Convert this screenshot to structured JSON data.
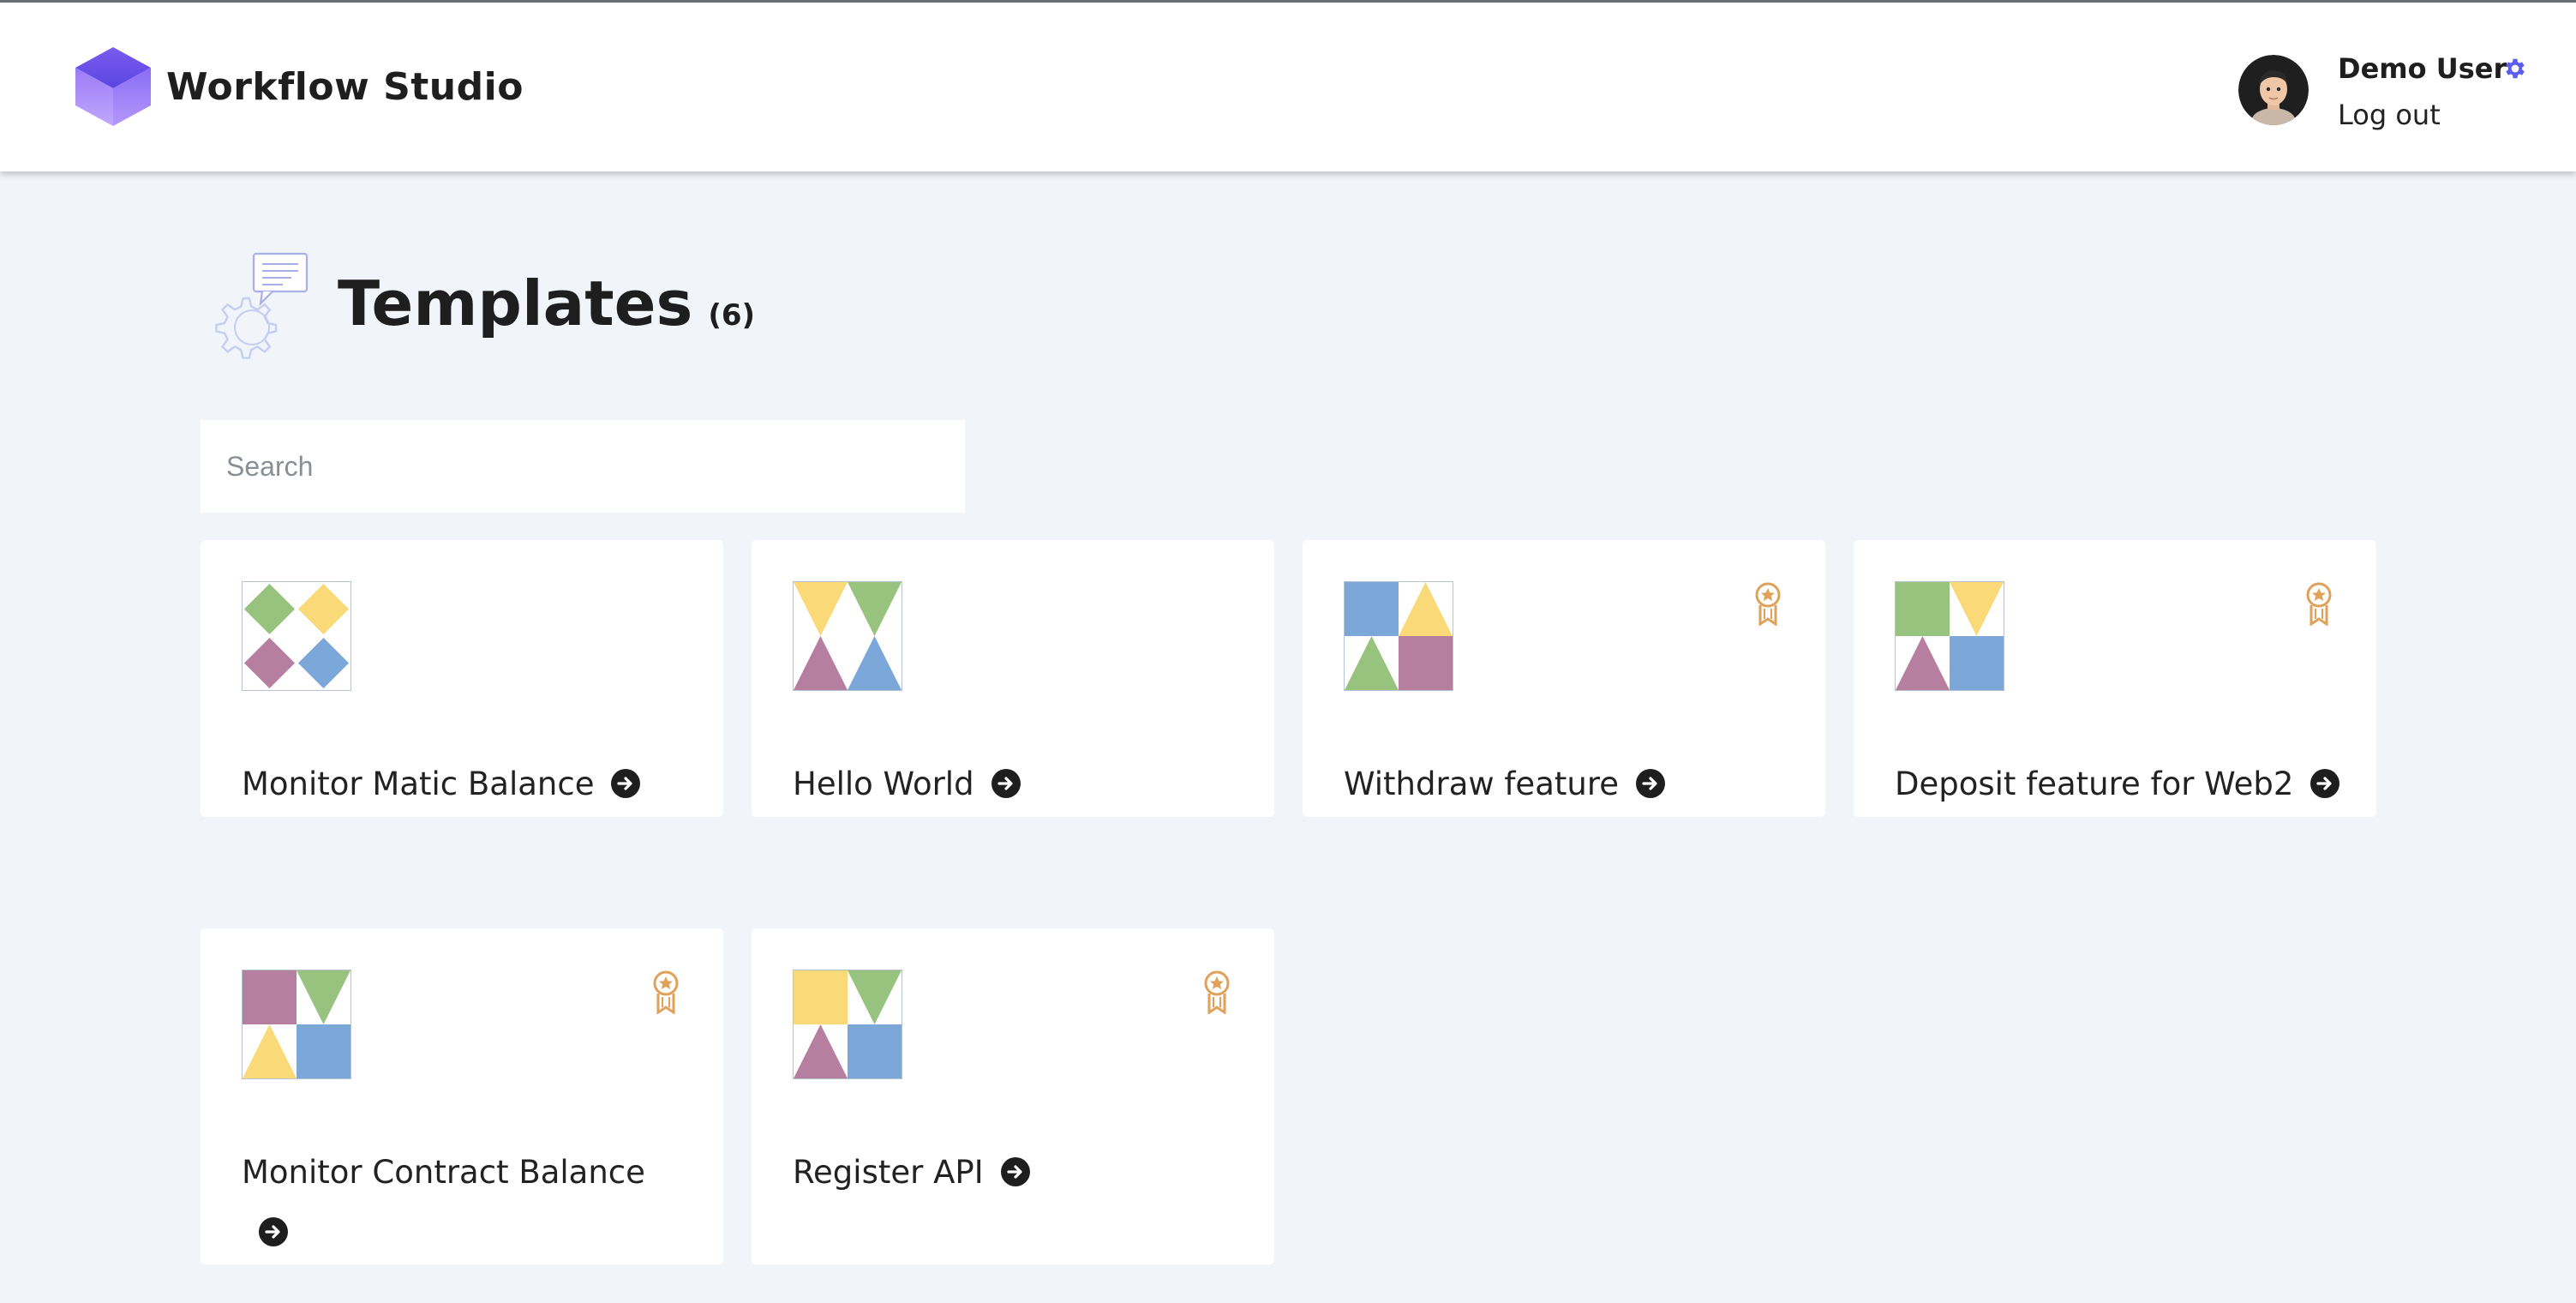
{
  "header": {
    "app_name": "Workflow Studio",
    "user_name": "Demo User",
    "logout_label": "Log out"
  },
  "page": {
    "title": "Templates",
    "count": "(6)"
  },
  "search": {
    "placeholder": "Search",
    "value": ""
  },
  "templates": [
    {
      "name": "Monitor Matic Balance",
      "premium": false
    },
    {
      "name": "Hello World",
      "premium": false
    },
    {
      "name": "Withdraw feature",
      "premium": true
    },
    {
      "name": "Deposit feature for Web2",
      "premium": true
    },
    {
      "name": "Monitor Contract Balance",
      "premium": true
    },
    {
      "name": "Register API",
      "premium": true
    }
  ],
  "colors": {
    "green": "#97c37e",
    "yellow": "#f9d978",
    "mauve": "#b67f9f",
    "blue": "#7ba7d9",
    "badge": "#e0a25a",
    "accent": "#6366f1"
  },
  "icons": {
    "logo": "hexagon-cube-logo",
    "settings": "gear-icon",
    "go": "arrow-right-circle-icon",
    "premium": "award-ribbon-icon"
  }
}
